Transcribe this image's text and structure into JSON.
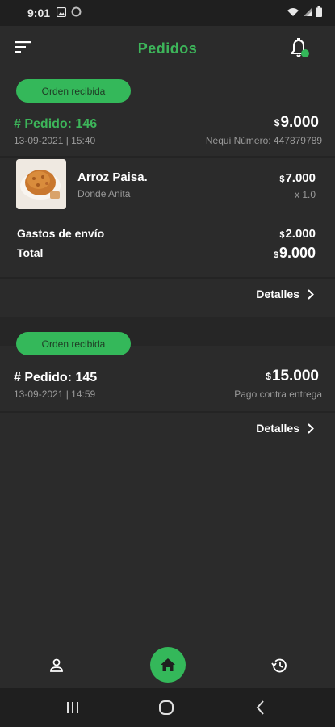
{
  "status_bar": {
    "time": "9:01"
  },
  "header": {
    "title": "Pedidos"
  },
  "orders": [
    {
      "badge": "Orden recibida",
      "number": "# Pedido: 146",
      "date": "13-09-2021 | 15:40",
      "currency": "$",
      "total": "9.000",
      "payment": "Nequi Número: 447879789",
      "items": [
        {
          "name": "Arroz Paisa.",
          "restaurant": "Donde Anita",
          "currency": "$",
          "price": "7.000",
          "qty": "x 1.0"
        }
      ],
      "shipping_label": "Gastos de envío",
      "shipping_currency": "$",
      "shipping_value": "2.000",
      "total_label": "Total",
      "total_currency": "$",
      "total_value": "9.000",
      "details_label": "Detalles"
    },
    {
      "badge": "Orden recibida",
      "number": "# Pedido: 145",
      "date": "13-09-2021 | 14:59",
      "currency": "$",
      "total": "15.000",
      "payment": "Pago contra entrega",
      "details_label": "Detalles"
    }
  ],
  "colors": {
    "accent": "#34b85a",
    "title_green": "#3db55a",
    "background": "#2b2b2b"
  },
  "icons": {
    "header_left": "filter-icon",
    "header_right": "bell-icon",
    "nav_left": "profile-icon",
    "nav_center": "home-icon",
    "nav_right": "history-icon"
  }
}
